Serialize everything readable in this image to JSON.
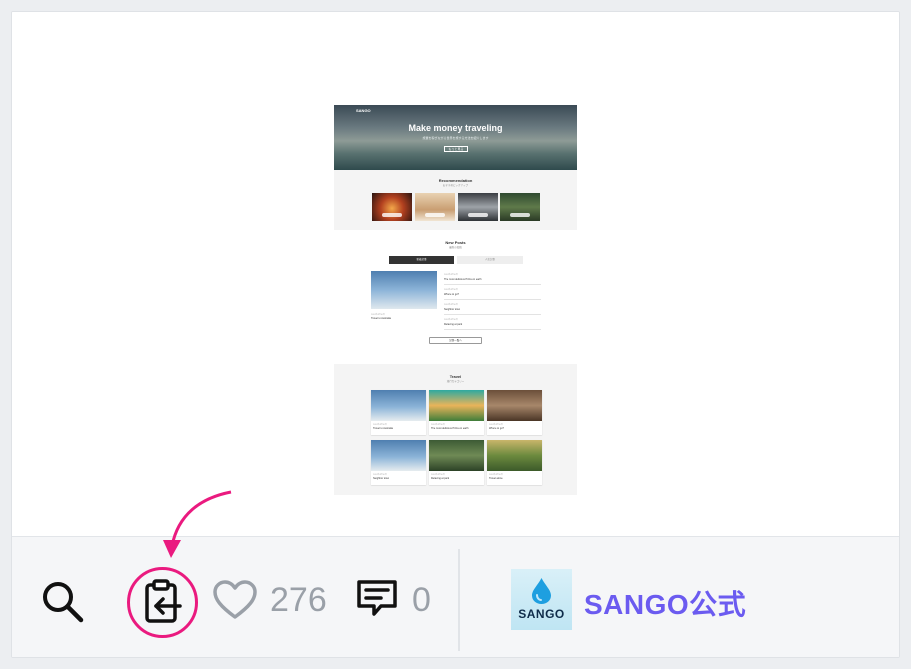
{
  "preview": {
    "site_logo": "SANGO",
    "hero_title": "Make money traveling",
    "hero_subtitle": "旅費を稼ぎながら世界を旅する方法を紹介します",
    "hero_button": "もっと見る",
    "recommendation_title": "Recommendation",
    "recommendation_subtitle": "おすすめピックアップ",
    "new_posts_title": "New Posts",
    "new_posts_subtitle": "最新の投稿",
    "tabs": [
      "新着記事",
      "人気記事"
    ],
    "featured_date": "2018年4月10日",
    "featured_caption": "Travel to Australia",
    "list": [
      {
        "date": "2018年4月10日",
        "title": "The most delicious Pizza on earth"
      },
      {
        "date": "2018年4月10日",
        "title": "Where to go?"
      },
      {
        "date": "2018年4月10日",
        "title": "Neighbor town"
      },
      {
        "date": "2018年4月10日",
        "title": "Relaxing at park"
      }
    ],
    "more_button": "記事一覧へ",
    "travel_title": "Travel",
    "travel_subtitle": "旅行カテゴリー",
    "travel_cards": [
      {
        "date": "2018年4月10日",
        "title": "Travel to Australia"
      },
      {
        "date": "2018年4月10日",
        "title": "The most delicious Pizza on earth"
      },
      {
        "date": "2018年4月10日",
        "title": "Where to go?"
      },
      {
        "date": "2018年4月10日",
        "title": "Neighbor town"
      },
      {
        "date": "2018年4月10日",
        "title": "Relaxing at park"
      },
      {
        "date": "2018年4月10日",
        "title": "Travel alone"
      }
    ]
  },
  "toolbar": {
    "search_icon": "search-icon",
    "clip_icon": "clipboard-import-icon",
    "like_icon": "heart-icon",
    "like_count": "276",
    "comment_icon": "comment-icon",
    "comment_count": "0",
    "avatar_text": "SANGO",
    "author_name": "SANGO公式"
  },
  "colors": {
    "accent": "#6b5bf0",
    "highlight": "#ea1a7f",
    "count_gray": "#9aa0a8"
  }
}
